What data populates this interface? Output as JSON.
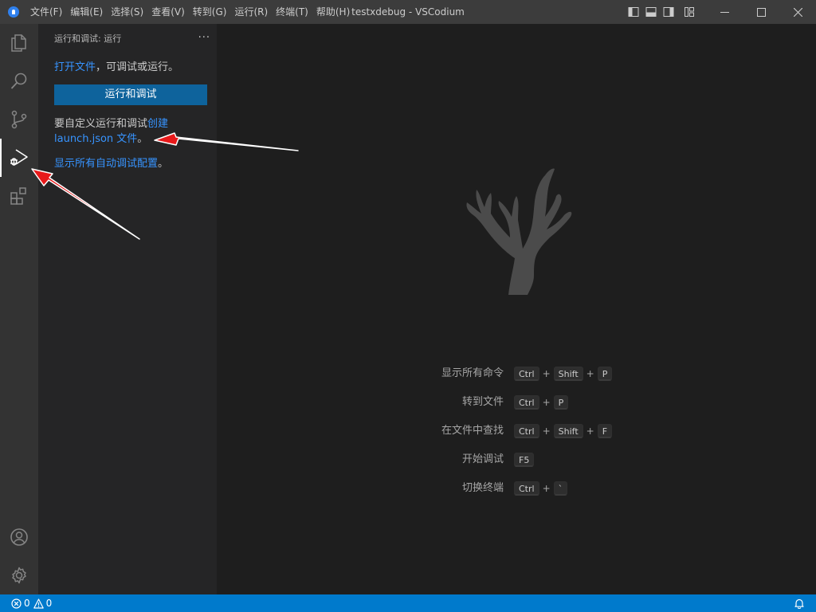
{
  "titlebar": {
    "menu": [
      "文件(F)",
      "编辑(E)",
      "选择(S)",
      "查看(V)",
      "转到(G)",
      "运行(R)",
      "终端(T)",
      "帮助(H)"
    ],
    "title": "testxdebug - VSCodium"
  },
  "activitybar": {
    "items": [
      "explorer-icon",
      "search-icon",
      "source-control-icon",
      "run-debug-icon",
      "extensions-icon"
    ],
    "bottom_items": [
      "account-icon",
      "settings-gear-icon"
    ],
    "active": "run-debug-icon"
  },
  "sidebar": {
    "title": "运行和调试: 运行",
    "more": "···",
    "open_file_link": "打开文件",
    "open_file_suffix": "，可调试或运行。",
    "run_button": "运行和调试",
    "customize_prefix": "要自定义运行和调试",
    "create_link": "创建 launch.json 文件",
    "customize_suffix": "。",
    "show_all_link": "显示所有自动调试配置",
    "show_all_suffix": "。"
  },
  "editor": {
    "watermark_icon": "vscodium-coral-logo",
    "shortcuts": [
      {
        "label": "显示所有命令",
        "keys": [
          "Ctrl",
          "Shift",
          "P"
        ]
      },
      {
        "label": "转到文件",
        "keys": [
          "Ctrl",
          "P"
        ]
      },
      {
        "label": "在文件中查找",
        "keys": [
          "Ctrl",
          "Shift",
          "F"
        ]
      },
      {
        "label": "开始调试",
        "keys": [
          "F5"
        ]
      },
      {
        "label": "切换终端",
        "keys": [
          "Ctrl",
          "`"
        ]
      }
    ],
    "plus": "+"
  },
  "statusbar": {
    "errors": "0",
    "warnings": "0"
  },
  "colors": {
    "titlebar": "#3c3c3c",
    "activitybar": "#333333",
    "sidebar": "#252526",
    "editor": "#1e1e1e",
    "statusbar": "#007acc",
    "link": "#3794ff",
    "button": "#0e639c",
    "annotation_arrow": "#e8191a"
  }
}
